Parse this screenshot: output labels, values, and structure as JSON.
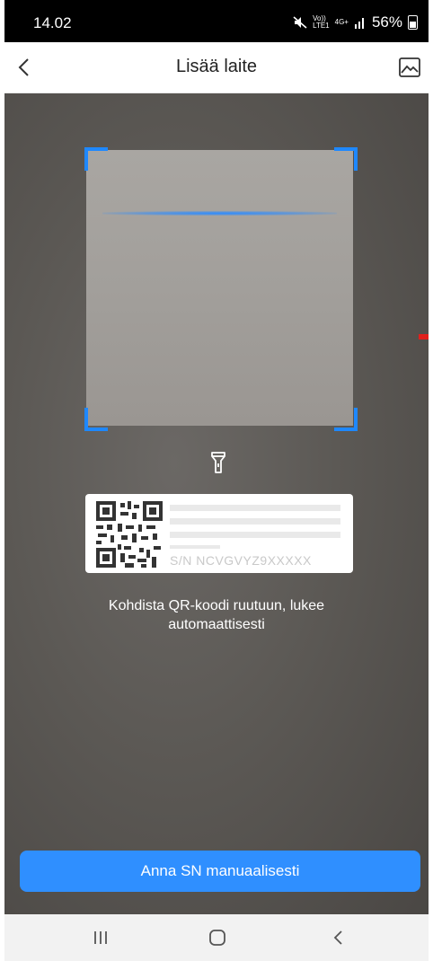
{
  "status_bar": {
    "time": "14.02",
    "network_line1": "Vo))",
    "network_line2": "LTE1",
    "net_type": "4G+",
    "battery": "56%",
    "icons": [
      "mute-icon",
      "signal-icon",
      "battery-icon"
    ]
  },
  "header": {
    "title": "Lisää laite",
    "back_icon": "chevron-left-icon",
    "gallery_icon": "image-gallery-icon"
  },
  "scanner": {
    "flashlight_icon": "flashlight-icon",
    "label_sample": {
      "sn_text": "S/N  NCVGVYZ9XXXXX"
    },
    "hint": "Kohdista QR-koodi ruutuun, lukee automaattisesti",
    "accent_color": "#1e88ff"
  },
  "manual_button": {
    "label": "Anna SN manuaalisesti",
    "color": "#2f8fff"
  },
  "navbar": {
    "items": [
      "recent-apps-icon",
      "home-icon",
      "back-icon"
    ]
  }
}
